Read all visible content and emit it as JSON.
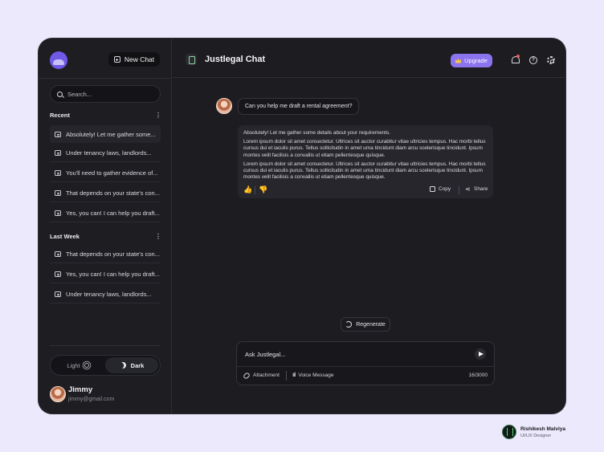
{
  "sidebar": {
    "new_chat_label": "New Chat",
    "search_placeholder": "Search...",
    "sections": [
      {
        "title": "Recent",
        "items": [
          {
            "label": "Absolutely! Let me gather some..."
          },
          {
            "label": "Under tenancy laws, landlords..."
          },
          {
            "label": "You'll need to gather evidence of..."
          },
          {
            "label": "That depends on your state's con..."
          },
          {
            "label": "Yes, you can! I can help you draft..."
          }
        ]
      },
      {
        "title": "Last Week",
        "items": [
          {
            "label": "That depends on your state's con..."
          },
          {
            "label": "Yes, you can! I can help you draft..."
          },
          {
            "label": "Under tenancy laws, landlords..."
          }
        ]
      }
    ],
    "theme": {
      "light_label": "Light",
      "dark_label": "Dark",
      "selected": "Dark"
    },
    "user": {
      "name": "Jimmy",
      "email": "jimmy@gmail.com"
    }
  },
  "header": {
    "title": "Justlegal Chat",
    "upgrade_label": "Upgrade",
    "help_glyph": "?"
  },
  "conversation": {
    "user_message": "Can you help me draft a rental agreement?",
    "bot_intro": "Absolutely! Let me gather some details about your requirements.",
    "bot_paragraphs": [
      "Lorem ipsum dolor sit amet consectetur. Ultrices sit auctor curabitur vitae ultricies tempus. Hac morbi tellus cursus dui et iaculis purus. Tellus sollicitudin in amet urna tincidunt diam arcu scelerisque tincidunt. Ipsum montes velit facilisis a convallis ut etiam pellentesque quisque.",
      "Lorem ipsum dolor sit amet consectetur. Ultrices sit auctor curabitur vitae ultricies tempus. Hac morbi tellus cursus dui et iaculis purus. Tellus sollicitudin in amet urna tincidunt diam arcu scelerisque tincidunt. Ipsum montes velit facilisis a convallis ut etiam pellentesque quisque."
    ],
    "copy_label": "Copy",
    "share_label": "Share"
  },
  "composer": {
    "regenerate_label": "Regenerate",
    "input_placeholder": "Ask Justlegal...",
    "attachment_label": "Attachment",
    "voice_label": "Voice Message",
    "char_count": "16/3000"
  },
  "credit": {
    "name": "Rishikesh Malviya",
    "role": "UI/UX Designer"
  },
  "colors": {
    "accent": "#8b74ee",
    "background": "#1c1c21",
    "page": "#ebe9fb"
  }
}
